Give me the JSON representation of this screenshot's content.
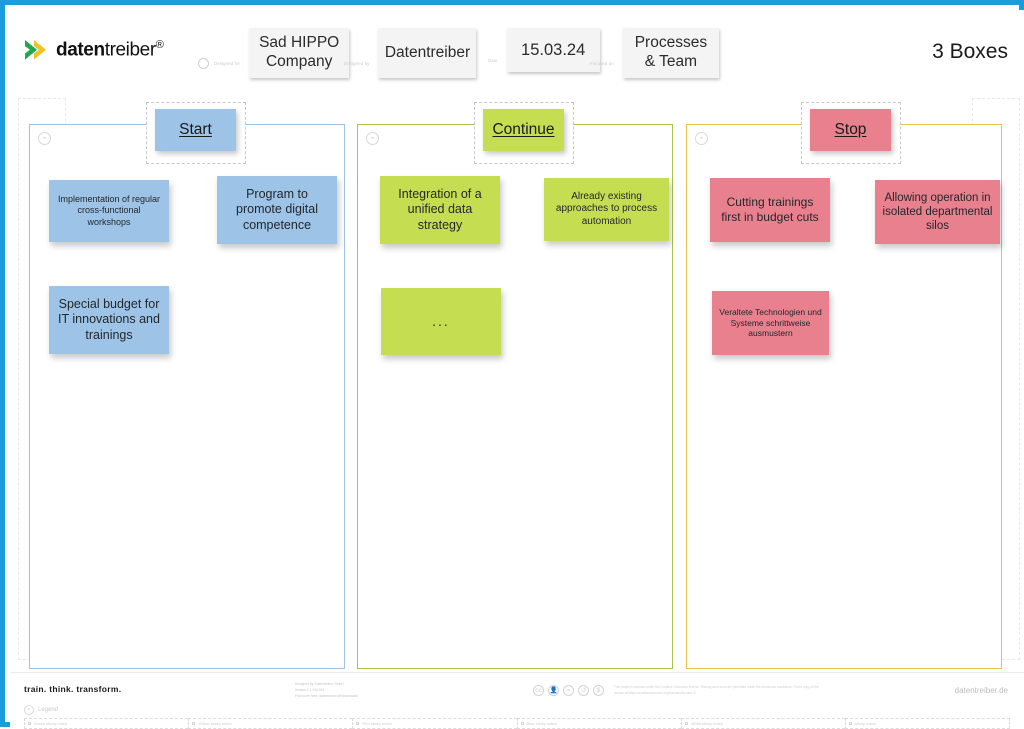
{
  "frame": {
    "accent": "#1B9DD9"
  },
  "header": {
    "logo": {
      "bold": "daten",
      "light": "treiber",
      "reg": "®",
      "icon": "chevron-logo"
    },
    "title_right": "3 Boxes",
    "fields": [
      {
        "label": "Designed for",
        "value": "Sad HIPPO\nCompany",
        "icon": "designed-for-icon"
      },
      {
        "label": "Designed by",
        "value": "Datentreiber",
        "icon": "designed-by-icon"
      },
      {
        "label": "Date",
        "value": "15.03.24",
        "icon": "date-icon"
      },
      {
        "label": "Focused on",
        "value": "Processes\n& Team",
        "icon": "focus-icon"
      }
    ]
  },
  "columns": [
    {
      "id": "start",
      "tab_label": "Start",
      "tab_color": "#9DC3E6",
      "border_color": "#9DC3E6",
      "note_color": "#9DC3E6",
      "notes": [
        {
          "text": "Implementation of regular cross-functional workshops",
          "font": 9
        },
        {
          "text": "Program to promote digital competence",
          "font": 12.5
        },
        {
          "text": "Special budget for IT innovations and trainings",
          "font": 12.5
        }
      ]
    },
    {
      "id": "continue",
      "tab_label": "Continue",
      "tab_color": "#C5DE51",
      "border_color": "#A9C44A",
      "note_color": "#C5DE51",
      "notes": [
        {
          "text": "Integration of a unified data strategy",
          "font": 12.5
        },
        {
          "text": "Already existing approaches to process automation",
          "font": 10
        },
        {
          "text": "...",
          "font": 14
        }
      ]
    },
    {
      "id": "stop",
      "tab_label": "Stop",
      "tab_color": "#E8808E",
      "border_color": "#E8C24A",
      "note_color": "#E8808E",
      "notes": [
        {
          "text": "Cutting trainings first in budget cuts",
          "font": 12
        },
        {
          "text": "Allowing operation in isolated departmental silos",
          "font": 11.5
        },
        {
          "text": "Veraltete Technologien und Systeme schrittweise ausmustern",
          "font": 8.5
        }
      ]
    }
  ],
  "footer": {
    "tagline": "train. think. transform.",
    "credits": "Designed by: Datentreiber GmbH\nVersion 1.1 03/2024\nFind more here: datentreiber.de/downloads",
    "cc_icons": [
      "cc-icon",
      "cc-by-icon",
      "cc-nd-icon",
      "cc-sa-icon",
      "cc-nc-icon"
    ],
    "cc_text": "This model is licensed under the Creative Commons license. Sharing and reuse are permitted under the mentioned conditions. Find a copy of the license at https://creativecommons.org/licenses/by-sa/4.0/",
    "site": "datentreiber.de",
    "legend_label": "Legend",
    "legend_icon": "legend-icon",
    "legend_items": [
      "Green sticky notes",
      "Yellow sticky notes",
      "Red sticky notes",
      "Blue sticky notes",
      "White sticky notes",
      "sticky notes"
    ]
  }
}
